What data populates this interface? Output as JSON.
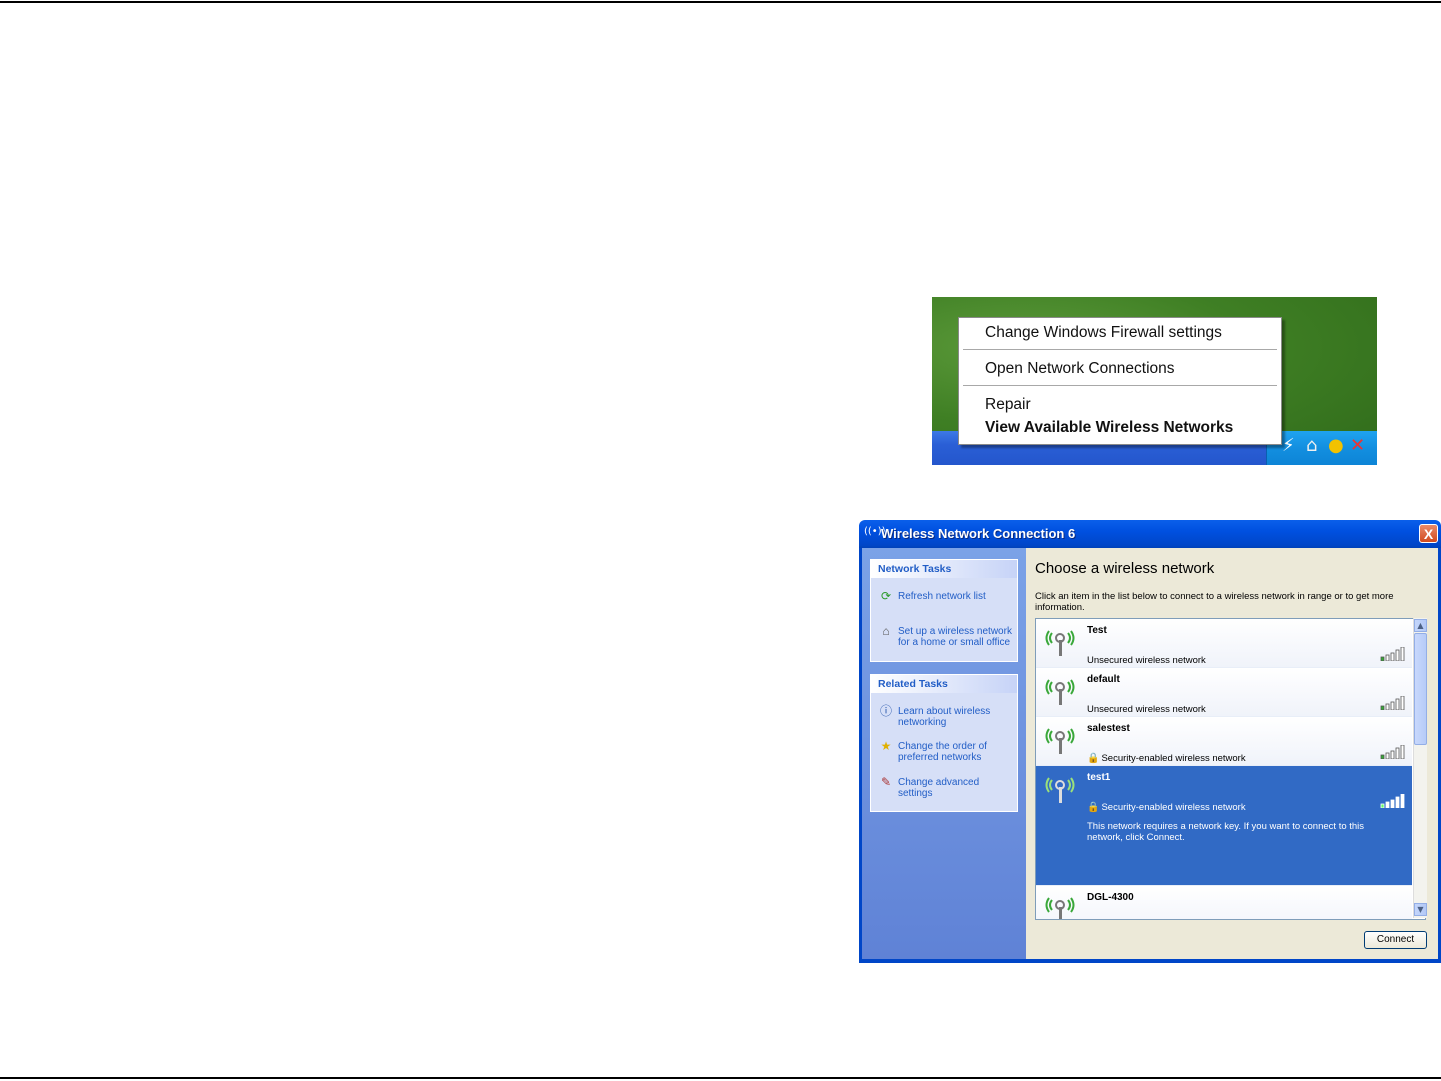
{
  "tray_menu": {
    "items": [
      "Change Windows Firewall settings",
      "Open Network Connections",
      "Repair"
    ],
    "default_item": "View Available Wireless Networks"
  },
  "dialog": {
    "title": "Wireless Network Connection 6",
    "close_label": "X",
    "network_tasks": {
      "header": "Network Tasks",
      "items": [
        "Refresh network list",
        "Set up a wireless network for a home or small office"
      ]
    },
    "related_tasks": {
      "header": "Related Tasks",
      "items": [
        "Learn about wireless networking",
        "Change the order of preferred networks",
        "Change advanced settings"
      ]
    },
    "heading": "Choose a wireless network",
    "instructions": "Click an item in the list below to connect to a wireless network in range or to get more information.",
    "networks": [
      {
        "ssid": "Test",
        "status": "Unsecured wireless network",
        "secured": false
      },
      {
        "ssid": "default",
        "status": "Unsecured wireless network",
        "secured": false
      },
      {
        "ssid": "salestest",
        "status": "Security-enabled wireless network",
        "secured": true
      },
      {
        "ssid": "test1",
        "status": "Security-enabled wireless network",
        "secured": true,
        "selected": true,
        "message": "This network requires a network key. If you want to connect to this network, click Connect."
      },
      {
        "ssid": "DGL-4300",
        "status": "",
        "secured": false
      }
    ],
    "connect_label": "Connect"
  }
}
